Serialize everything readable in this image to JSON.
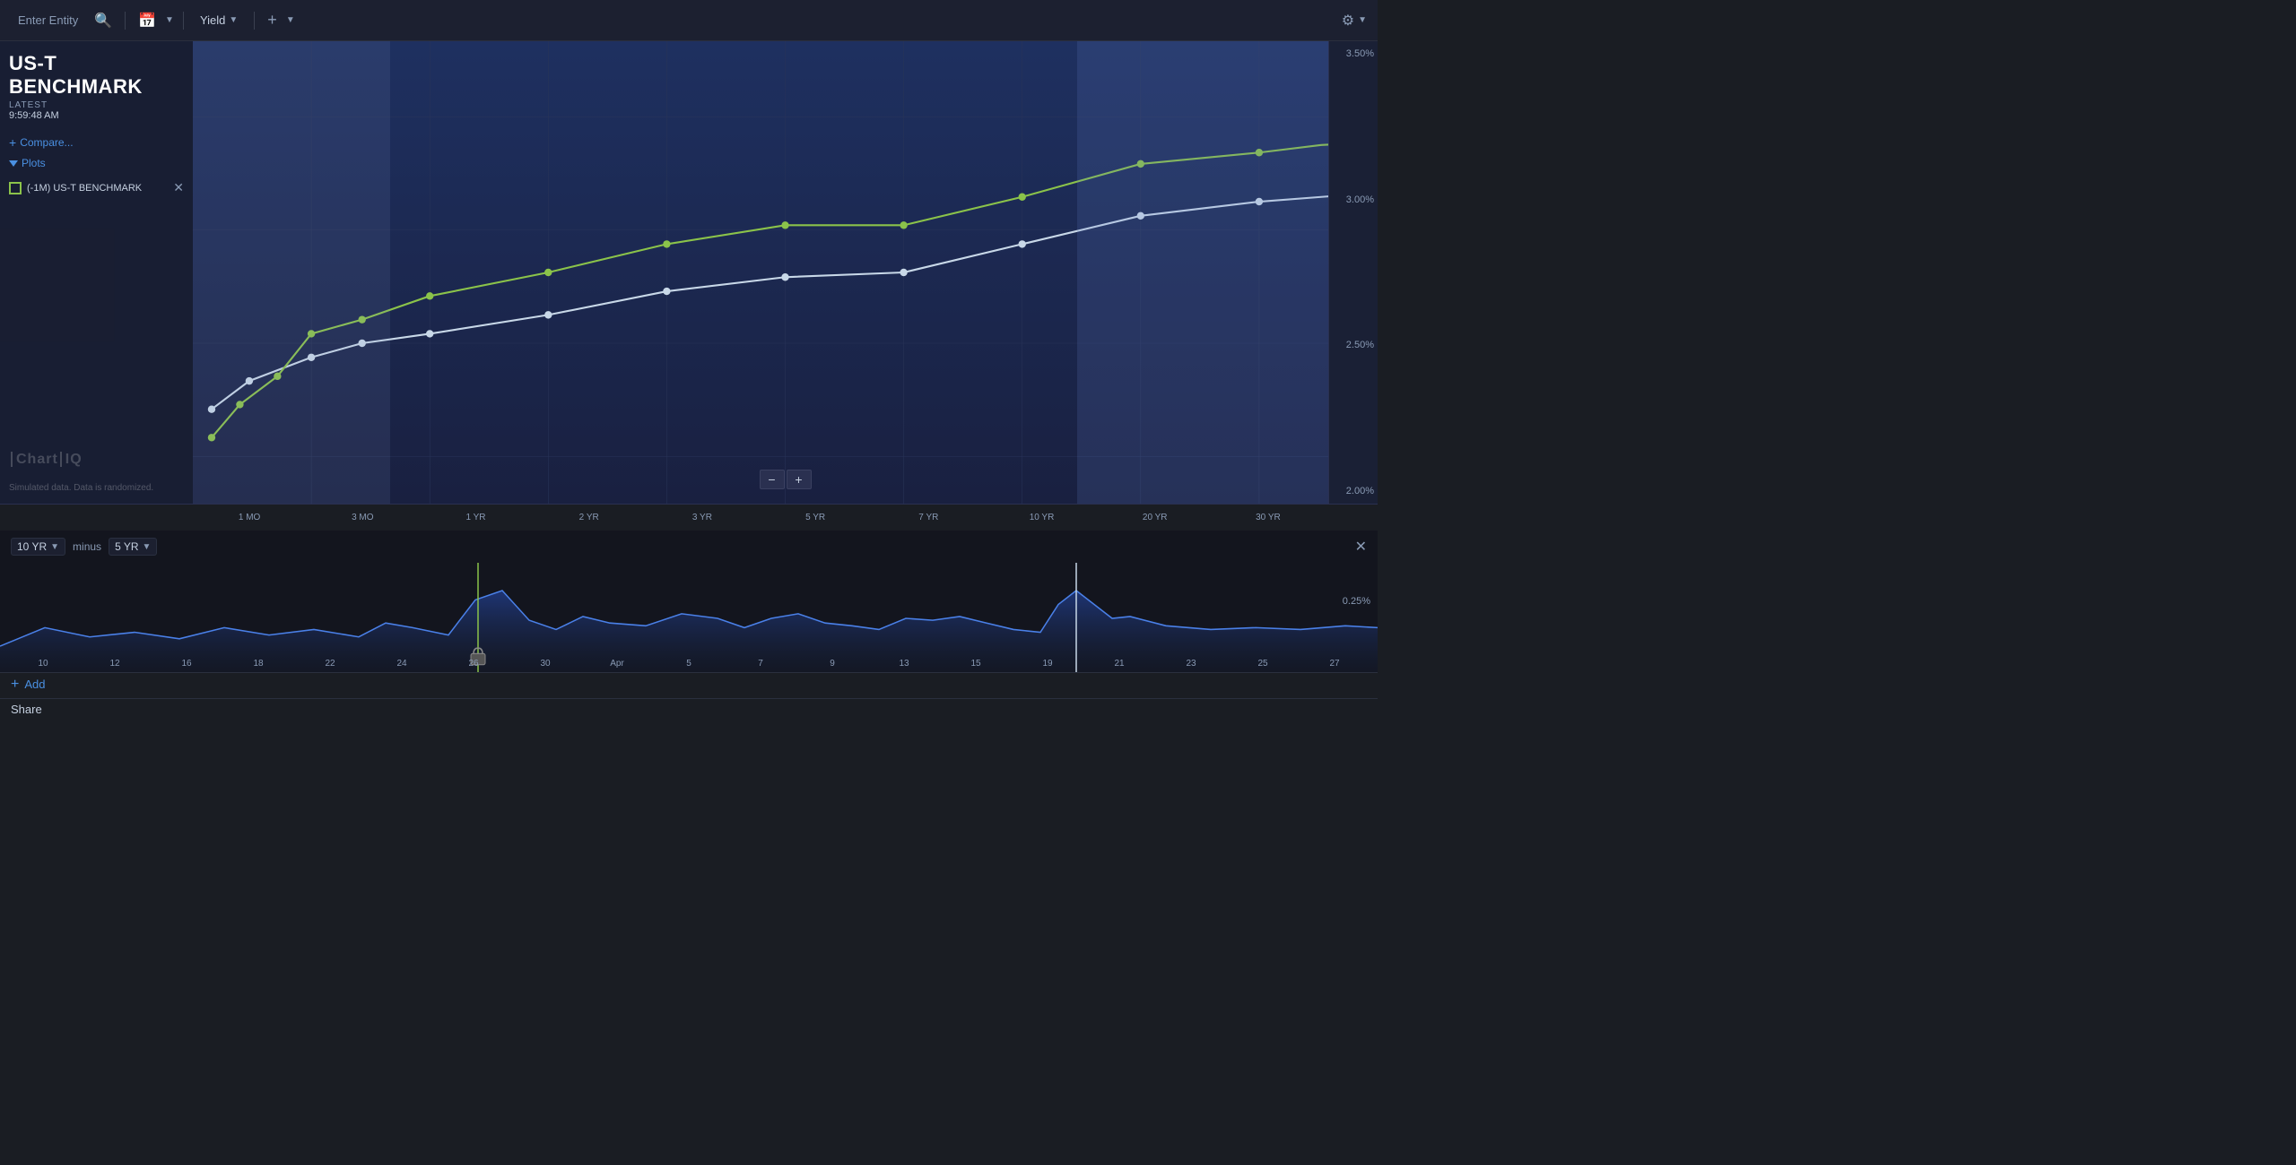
{
  "header": {
    "entity_placeholder": "Enter Entity",
    "yield_label": "Yield",
    "settings_icon": "gear-icon",
    "search_icon": "search-icon",
    "calendar_icon": "calendar-icon",
    "plus_icon": "plus-icon",
    "chevron_icon": "chevron-down-icon"
  },
  "chart": {
    "title": "US-T BENCHMARK",
    "latest_label": "LATEST",
    "latest_time": "9:59:48 AM",
    "compare_label": "Compare...",
    "plots_label": "Plots",
    "plot_item_label": "(-1M) US-T BENCHMARK",
    "logo_text": "Chart",
    "logo_suffix": "IQ",
    "simulated_notice": "Simulated data.  Data is randomized.",
    "zoom_minus": "−",
    "zoom_plus": "+",
    "y_axis_labels": [
      "3.50%",
      "3.00%",
      "2.50%",
      "2.00%"
    ],
    "x_axis_labels": [
      "1 MO",
      "3 MO",
      "1 YR",
      "2 YR",
      "3 YR",
      "5 YR",
      "7 YR",
      "10 YR",
      "20 YR",
      "30 YR"
    ],
    "colors": {
      "background": "#1e2a50",
      "background_dark": "#1a2240",
      "line_green": "#8bc34a",
      "line_white": "#c8d8e8",
      "shade1": "rgba(100,130,200,0.12)",
      "shade2": "rgba(80,110,190,0.18)"
    }
  },
  "lower_chart": {
    "selector1_label": "10 YR",
    "minus_label": "minus",
    "selector2_label": "5 YR",
    "y_label": "0.25%",
    "x_labels": [
      "10",
      "12",
      "16",
      "18",
      "22",
      "24",
      "26",
      "30",
      "Apr",
      "5",
      "7",
      "9",
      "13",
      "15",
      "19",
      "21",
      "23",
      "25",
      "27"
    ],
    "close_icon": "close-icon"
  },
  "footer": {
    "add_label": "Add",
    "share_label": "Share"
  }
}
